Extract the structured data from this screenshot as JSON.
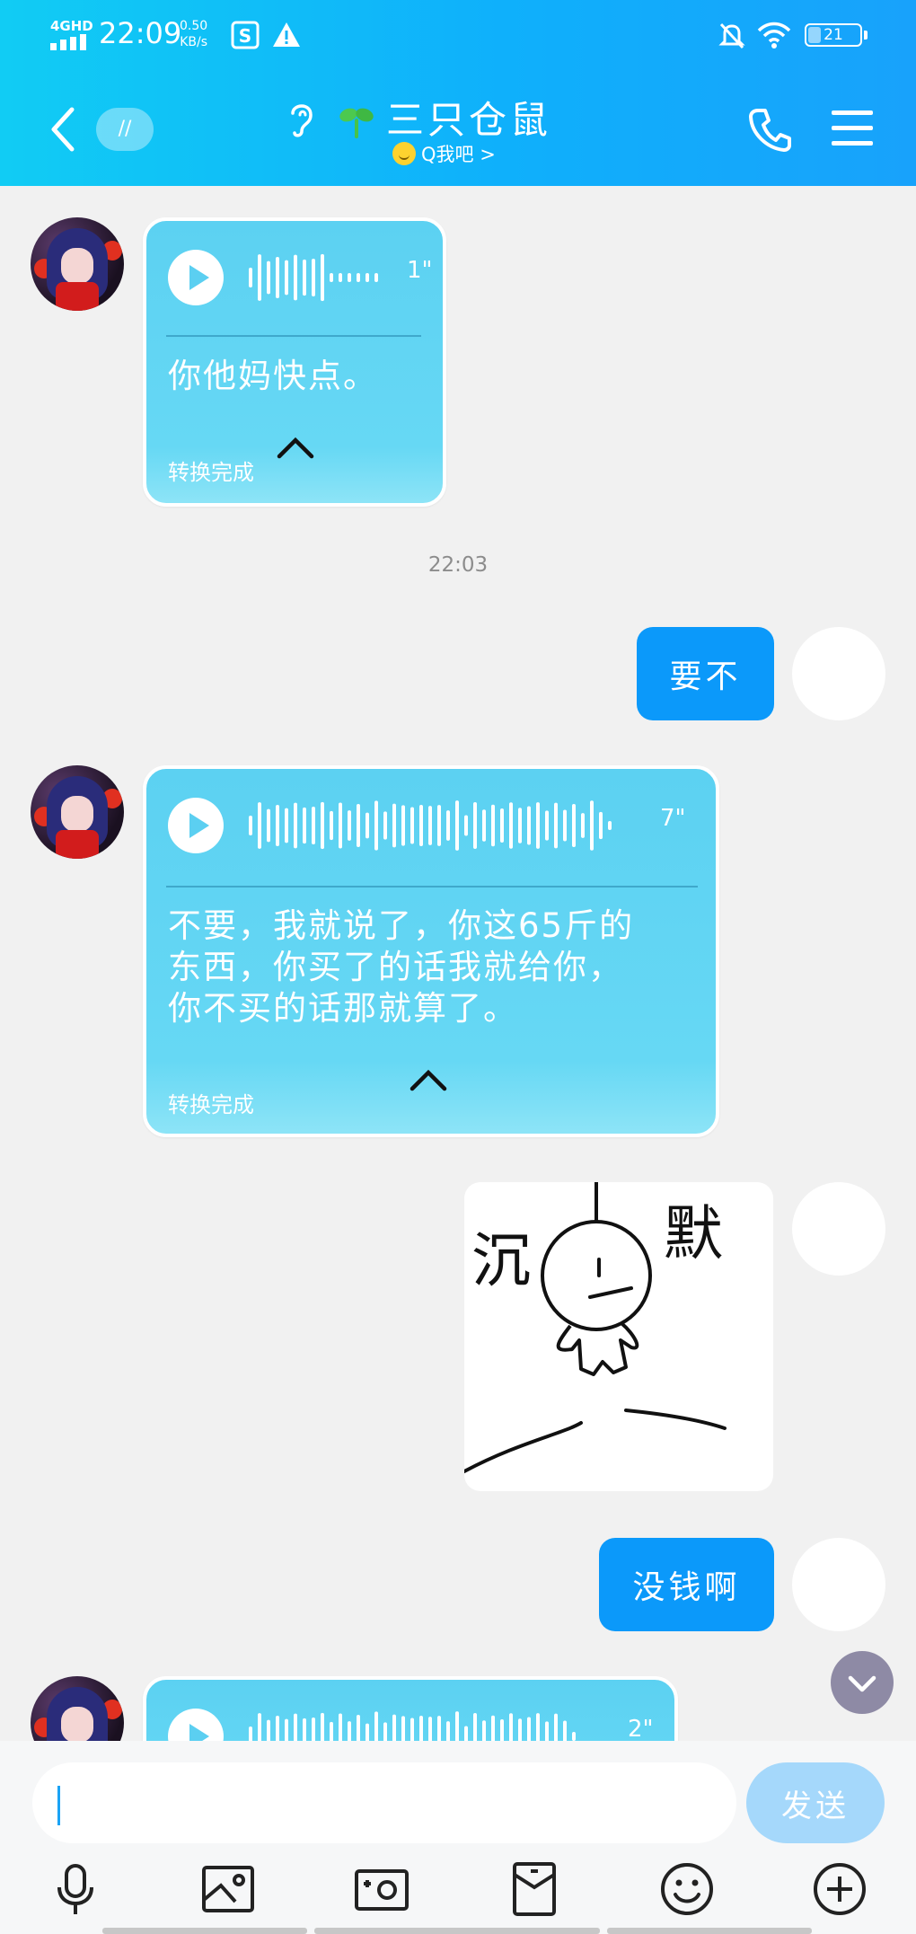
{
  "status_bar": {
    "network": "4GHD",
    "time": "22:09",
    "speed_value": "0.50",
    "speed_unit": "KB/s",
    "battery": "21"
  },
  "header": {
    "back_badge": "//",
    "title": "三只仓鼠",
    "subtitle": "Q我吧 >",
    "icons": [
      "back-arrow-icon",
      "ear-icon",
      "sprout-icon",
      "phone-icon",
      "menu-icon"
    ]
  },
  "messages": [
    {
      "type": "voice",
      "side": "left",
      "duration": "1\"",
      "transcript": "你他妈快点。",
      "status": "转换完成"
    },
    {
      "type": "time",
      "text": "22:03"
    },
    {
      "type": "text",
      "side": "right",
      "text": "要不"
    },
    {
      "type": "voice",
      "side": "left",
      "duration": "7\"",
      "transcript": [
        "不要，我就说了，你这65斤的",
        "东西，你买了的话我就给你，",
        "你不买的话那就算了。"
      ],
      "status": "转换完成"
    },
    {
      "type": "sticker",
      "side": "right",
      "caption": "沉默"
    },
    {
      "type": "text",
      "side": "right",
      "text": "没钱啊"
    },
    {
      "type": "voice",
      "side": "left",
      "duration": "2\""
    }
  ],
  "composer": {
    "placeholder": "",
    "send_label": "发送",
    "tools": [
      "microphone-icon",
      "image-icon",
      "camera-icon",
      "red-packet-icon",
      "emoji-icon",
      "plus-icon"
    ]
  },
  "colors": {
    "header_start": "#11ccf4",
    "header_end": "#18a2fb",
    "voice_bubble": "#5cd1f2",
    "outgoing_bubble": "#0b99fa",
    "send_button": "#a5d8fb"
  }
}
